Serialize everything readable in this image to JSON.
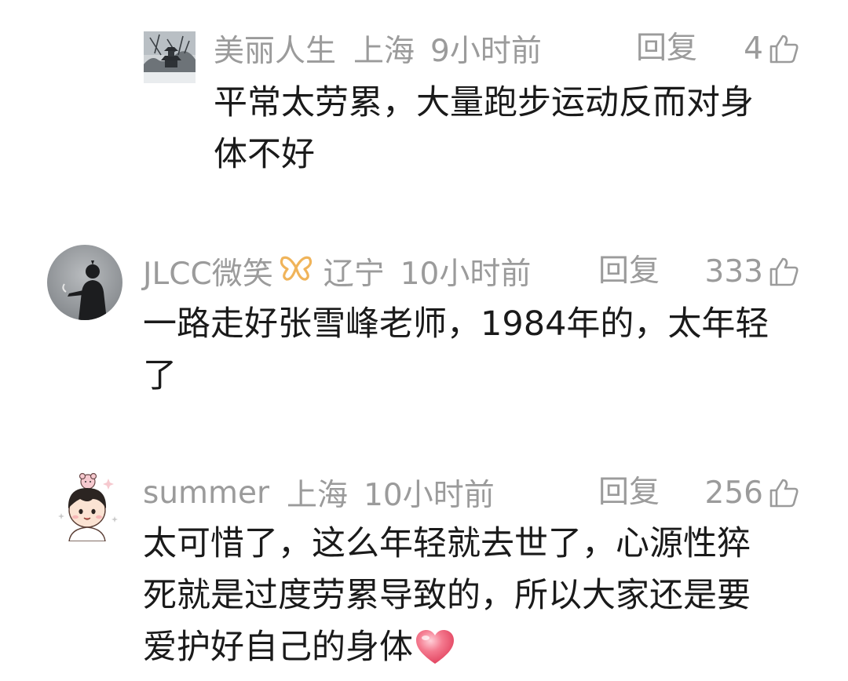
{
  "comments": [
    {
      "username": "美丽人生",
      "location": "上海",
      "time": "9小时前",
      "reply_label": "回复",
      "likes": "4",
      "lines": [
        "平常太劳累，大量跑步运动反而对身",
        "体不好"
      ],
      "avatar_icon": "snowy-pagoda-avatar"
    },
    {
      "username": "JLCC微笑",
      "location": "辽宁",
      "time": "10小时前",
      "reply_label": "回复",
      "likes": "333",
      "lines": [
        "一路走好张雪峰老师，1984年的，太年轻",
        "了"
      ],
      "avatar_icon": "silhouette-avatar",
      "badge_icon": "butterfly-icon",
      "badge_color": "#f0b45a"
    },
    {
      "username": "summer",
      "location": "上海",
      "time": "10小时前",
      "reply_label": "回复",
      "likes": "256",
      "lines": [
        "太可惜了，这么年轻就去世了，心源性猝",
        "死就是过度劳累导致的，所以大家还是要",
        "爱护好自己的身体"
      ],
      "avatar_icon": "cartoon-boy-avatar",
      "emoji_icon": "heart-icon"
    }
  ],
  "colors": {
    "meta_text": "#9b9b9b",
    "body_text": "#1a1a1a",
    "heart": "#ef5a73"
  }
}
